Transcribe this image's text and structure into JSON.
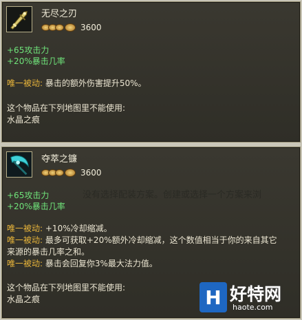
{
  "items": [
    {
      "name": "无尽之刃",
      "cost": "3600",
      "icon": "infinity-edge-sword-icon",
      "stats": [
        "+65攻击力",
        "+20%暴击几率"
      ],
      "passives": [
        {
          "label": "唯一被动:",
          "text": "暴击的额外伤害提升50%。"
        }
      ],
      "map_restriction_title": "这个物品在下列地图里不能使用:",
      "map_restriction_value": "水晶之痕"
    },
    {
      "name": "夺萃之镰",
      "cost": "3600",
      "icon": "essence-reaver-scythe-icon",
      "stats": [
        "+65攻击力",
        "+20%暴击几率"
      ],
      "passives": [
        {
          "label": "唯一被动:",
          "text": "+10%冷却缩减。"
        },
        {
          "label": "唯一被动:",
          "text": "最多可获取+20%额外冷却缩减，这个数值相当于你的来自其它"
        },
        {
          "label": "",
          "text": "来源的暴击几率之和。"
        },
        {
          "label": "唯一被动:",
          "text": "暴击会回复你3%最大法力值。"
        }
      ],
      "map_restriction_title": "这个物品在下列地图里不能使用:",
      "map_restriction_value": "水晶之痕"
    }
  ],
  "overlay_message": "没有选择配装方案。创建或选择一个方案来浏",
  "watermark": {
    "logo_glyph": "H",
    "name": "好特网",
    "url": "haote.com"
  },
  "colors": {
    "passive": "#e7b43a",
    "stat": "#6fe37a",
    "panel": "#33322b"
  }
}
